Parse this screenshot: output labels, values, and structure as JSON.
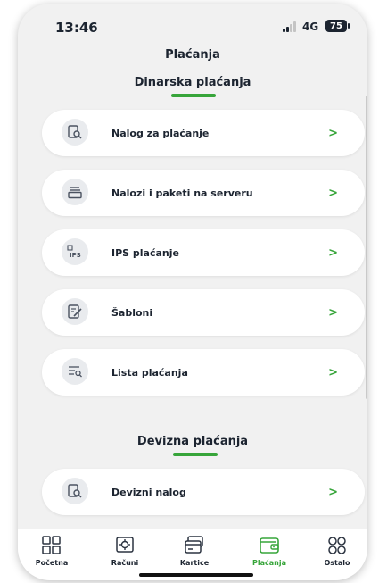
{
  "status_bar": {
    "time": "13:46",
    "network": "4G",
    "battery": "75"
  },
  "page_title": "Plaćanja",
  "sections": {
    "dinarska": {
      "title": "Dinarska plaćanja",
      "items": [
        {
          "label": "Nalog za plaćanje",
          "icon": "document-search-icon",
          "chevron": ">"
        },
        {
          "label": "Nalozi i paketi na serveru",
          "icon": "server-stack-icon",
          "chevron": ">"
        },
        {
          "label": "IPS plaćanje",
          "icon": "ips-qr-icon",
          "chevron": ">"
        },
        {
          "label": "Šabloni",
          "icon": "template-edit-icon",
          "chevron": ">"
        },
        {
          "label": "Lista plaćanja",
          "icon": "list-search-icon",
          "chevron": ">"
        }
      ]
    },
    "devizna": {
      "title": "Devizna plaćanja",
      "items": [
        {
          "label": "Devizni nalog",
          "icon": "document-search-icon",
          "chevron": ">"
        }
      ]
    }
  },
  "bottom_nav": {
    "items": [
      {
        "label": "Početna",
        "icon": "home-grid-icon"
      },
      {
        "label": "Računi",
        "icon": "accounts-icon"
      },
      {
        "label": "Kartice",
        "icon": "cards-icon"
      },
      {
        "label": "Plaćanja",
        "icon": "wallet-icon",
        "active": true
      },
      {
        "label": "Ostalo",
        "icon": "more-circles-icon"
      }
    ]
  },
  "colors": {
    "accent": "#37a53a",
    "text": "#1c2430",
    "background": "#f1f1f1",
    "card": "#ffffff"
  }
}
